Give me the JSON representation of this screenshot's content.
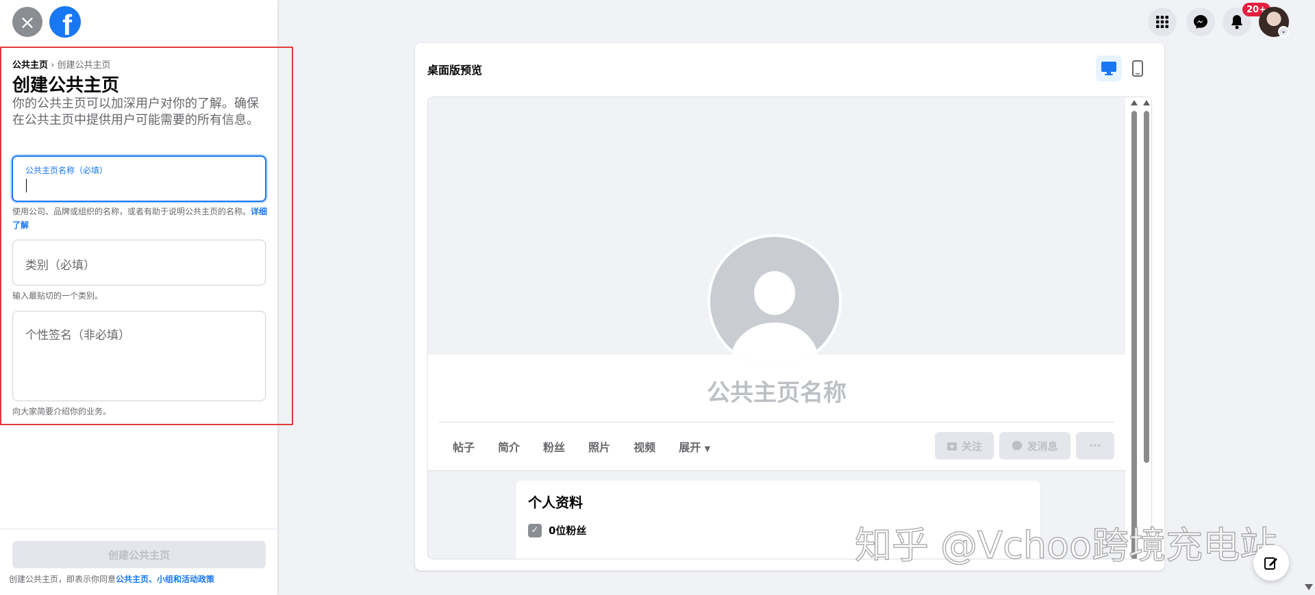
{
  "left_panel": {
    "breadcrumb": {
      "root": "公共主页",
      "separator": "›",
      "current": "创建公共主页"
    },
    "title": "创建公共主页",
    "description": "你的公共主页可以加深用户对你的了解。确保在公共主页中提供用户可能需要的所有信息。",
    "name_field": {
      "label": "公共主页名称（必填）",
      "value": ""
    },
    "name_hint": "使用公司、品牌或组织的名称，或者有助于说明公共主页的名称。",
    "learn_more": "详细了解",
    "category_field": {
      "placeholder": "类别（必填）",
      "value": ""
    },
    "category_hint": "输入最贴切的一个类别。",
    "bio_field": {
      "placeholder": "个性签名（非必填）",
      "value": ""
    },
    "bio_hint": "向大家简要介绍你的业务。",
    "create_button": "创建公共主页",
    "terms_prefix": "创建公共主页，即表示你同意",
    "terms_link": "公共主页、小组和活动政策"
  },
  "top_nav": {
    "notification_badge": "20+",
    "icons": [
      "menu-grid-icon",
      "messenger-icon",
      "bell-icon"
    ]
  },
  "preview": {
    "title": "桌面版预览",
    "page_name": "公共主页名称",
    "tabs": [
      "帖子",
      "简介",
      "粉丝",
      "照片",
      "视频",
      "展开"
    ],
    "actions": {
      "follow": "关注",
      "message": "发消息",
      "more": "···"
    },
    "about": {
      "title": "个人资料",
      "followers": "0位粉丝"
    }
  },
  "watermark": "知乎 @Vchoo跨境充电站",
  "colors": {
    "accent": "#1877f2",
    "highlight_outline": "#e03a3a",
    "badge": "#e41e3f",
    "background": "#f0f2f5"
  }
}
